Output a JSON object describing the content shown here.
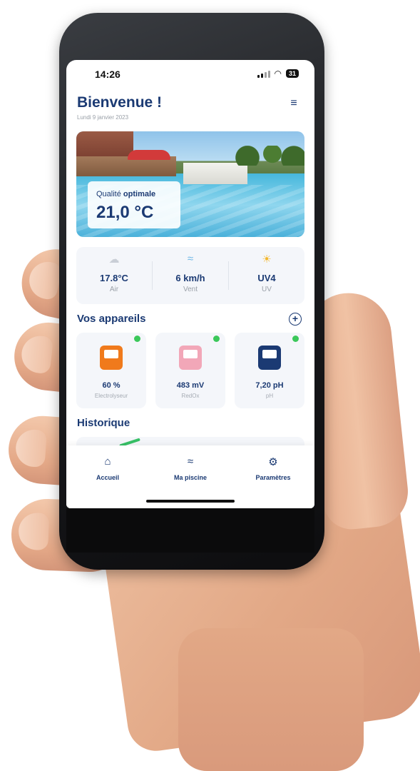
{
  "status_bar": {
    "time": "14:26",
    "battery": "31"
  },
  "header": {
    "title": "Bienvenue !",
    "date": "Lundi 9 janvier 2023"
  },
  "hero": {
    "quality_prefix": "Qualité",
    "quality_state": "optimale",
    "temperature": "21,0 °C"
  },
  "weather": [
    {
      "value": "17.8°C",
      "label": "Air",
      "icon": "cloud-icon"
    },
    {
      "value": "6 km/h",
      "label": "Vent",
      "icon": "wind-icon"
    },
    {
      "value": "UV4",
      "label": "UV",
      "icon": "sun-icon"
    }
  ],
  "devices_section": {
    "title": "Vos appareils"
  },
  "devices": [
    {
      "value": "60 %",
      "label": "Electrolyseur",
      "color": "#f07a1c",
      "status_color": "#3bc85a"
    },
    {
      "value": "483 mV",
      "label": "RedOx",
      "color": "#f2a7b8",
      "status_color": "#3bc85a"
    },
    {
      "value": "7,20 pH",
      "label": "pH",
      "color": "#1b3a73",
      "status_color": "#3bc85a"
    }
  ],
  "history_section": {
    "title": "Historique"
  },
  "nav": [
    {
      "label": "Accueil",
      "icon": "home-icon"
    },
    {
      "label": "Ma piscine",
      "icon": "pool-icon"
    },
    {
      "label": "Paramètres",
      "icon": "settings-gear-icon"
    }
  ],
  "colors": {
    "primary": "#1b3a73",
    "status_ok": "#3bc85a",
    "card_bg": "#f4f6fa"
  }
}
